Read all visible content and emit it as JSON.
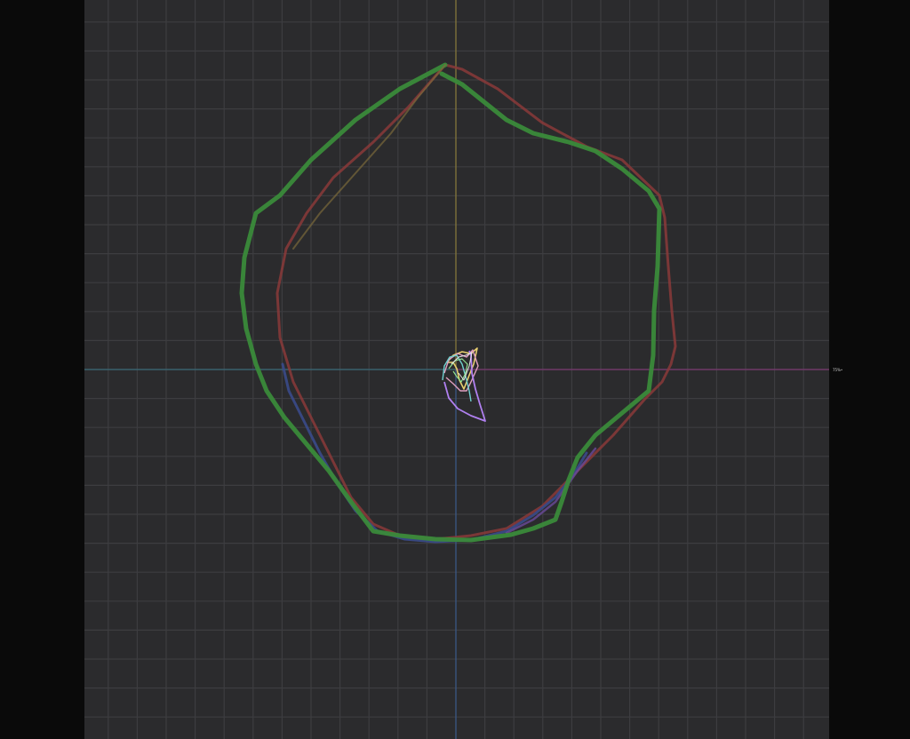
{
  "scope": {
    "right_axis_label": "75%•",
    "colors": {
      "background": "#0a0a0a",
      "panel": "#2b2b2d",
      "grid": "#3d3d40",
      "axis_vertical_top": "#9a8a3a",
      "axis_vertical_bottom": "#3a5a8a",
      "axis_horizontal_left": "#3a6a78",
      "axis_horizontal_right": "#8a3a7a",
      "hull_green": "#3a8a3a",
      "hull_red": "#8a3a3a",
      "hull_blue": "#3a4a8a",
      "hull_purple": "#7a4aa8"
    }
  }
}
